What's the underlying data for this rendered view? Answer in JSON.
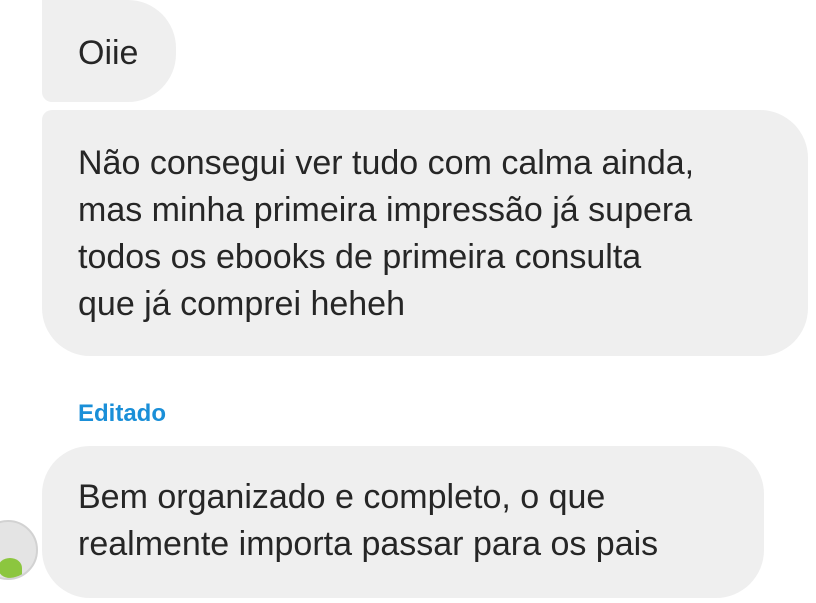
{
  "messages": [
    {
      "lines": [
        "Oiie"
      ]
    },
    {
      "lines": [
        "Não consegui ver tudo com calma ainda,",
        "mas minha primeira impressão já supera",
        "todos os ebooks de primeira consulta",
        "que já comprei heheh"
      ]
    },
    {
      "edited_label": "Editado",
      "lines": [
        "Bem organizado e completo, o que",
        "realmente importa passar para os pais"
      ]
    }
  ],
  "colors": {
    "bubble_bg": "#efefef",
    "text": "#262626",
    "edited_label": "#1a8fd8"
  },
  "icons": {
    "avatar": "sender-avatar"
  }
}
